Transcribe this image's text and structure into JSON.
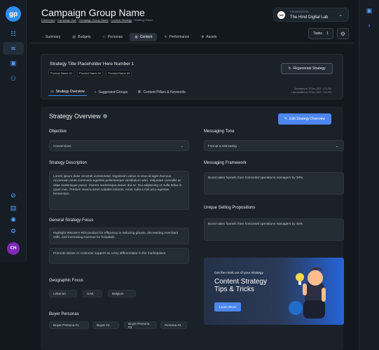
{
  "app": {
    "logo_text": "gp",
    "avatar_initials": "CH"
  },
  "header": {
    "title": "Campaign Group Name",
    "breadcrumb": [
      {
        "label": "Dashboard"
      },
      {
        "label": "Campaign Hub"
      },
      {
        "label": "Campaign Group Name"
      },
      {
        "label": "Content Strategy"
      },
      {
        "label": "Strategy Name"
      }
    ],
    "organization": {
      "label": "ORGANIZATION",
      "name": "The Hind Digital Lab",
      "logo": "hdl"
    },
    "tasks_label": "Tasks",
    "tasks_count": "1"
  },
  "tabs": [
    {
      "label": "Summary",
      "icon": "layers-icon"
    },
    {
      "label": "Budgets",
      "icon": "wallet-icon"
    },
    {
      "label": "Personas",
      "icon": "users-icon"
    },
    {
      "label": "Content",
      "icon": "file-icon",
      "active": true
    },
    {
      "label": "Performance",
      "icon": "chart-icon"
    },
    {
      "label": "Assets",
      "icon": "assets-icon"
    }
  ],
  "strategy": {
    "title": "Strategy Title Placeholder Here Number 1",
    "products": [
      "Product Name #1",
      "Product Name #2",
      "Product Name #3"
    ],
    "regenerate_label": "Regenerate Strategy",
    "subtabs": [
      {
        "label": "Strategy Overview",
        "active": true
      },
      {
        "label": "Suggested Groups"
      },
      {
        "label": "Content Pillars & Keywords"
      }
    ],
    "meta": {
      "created_line": "Generated on 10 Dec 2023 · 4:21 PM",
      "modified_line": "Last modified on 20 Dec 2023 · 4:21 PM"
    }
  },
  "overview": {
    "title": "Strategy Overview",
    "edit_label": "Edit Strategy Overview",
    "objective": {
      "label": "Objective",
      "value": "Conversions"
    },
    "messaging_tone": {
      "label": "Messaging Tone",
      "value": "Formal & Motivating"
    },
    "description": {
      "label": "Strategy Description",
      "text": "Lorem ipsum dolor sit amet consectetur. Dignissim varius in risus id aget rhoncus. Accumsan amet commodo egestas pellentesque vestibulum sem. Vulputate convallis ac vitae scelerisque purus. Viverra scelerisque donec dui ac. Dui adipiscing ut nulla tellus in quam nec. Pretium viverra amet sodales lobortis. Amet nulla a nisi arcu egestas fermentum."
    },
    "messaging_framework": {
      "label": "Messaging Framework",
      "text": "Boost sales funnels from horizontal operations managers by 30%."
    },
    "focus": {
      "label": "General Strategy Focus",
      "items": [
        "Highlight Wissee's ROI product for efficiency in reducing ghosts, decreasing merchant sells, and increasing revenue for hospitals.",
        "Promote Wisse AI customer support as a key differentiator in the marketplace."
      ]
    },
    "usp": {
      "label": "Unique Selling Propositions",
      "text": "Boost sales funnels from horizontal operations managers by 30%."
    },
    "geo": {
      "label": "Geographic Focus",
      "items": [
        "Lebanon",
        "UAE",
        "Belgium"
      ]
    },
    "personas": {
      "label": "Buyer Personas",
      "items": [
        "Buyer Persona #1",
        "Buyer #2",
        "Buyer Persona #3",
        "Persona #4"
      ]
    }
  },
  "promo": {
    "kicker": "Get the most out of your strategy",
    "title_line1": "Content Strategy",
    "title_line2": "Tips & Tricks",
    "button": "Learn More"
  },
  "colors": {
    "accent": "#4c86f0",
    "brand": "#2f8cf0",
    "avatar": "#7d2ab7"
  }
}
